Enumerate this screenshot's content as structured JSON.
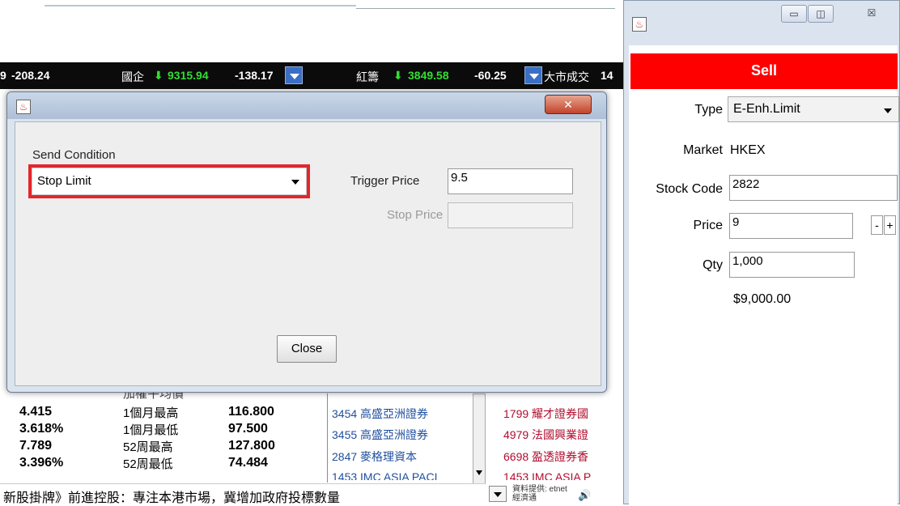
{
  "ticker": {
    "item1_change": "-208.24",
    "item2_label": "國企",
    "item2_arrow": "⬇",
    "item2_value": "9315.94",
    "item2_change": "-138.17",
    "item3_label": "紅籌",
    "item3_arrow": "⬇",
    "item3_value": "3849.58",
    "item3_change": "-60.25",
    "item4_label": "大市成交",
    "item4_value": "14",
    "lead_digit": "9"
  },
  "background_stats": {
    "col1": [
      "4.415",
      "3.618%",
      "7.789",
      "3.396%"
    ],
    "labels": [
      "1個月最高",
      "1個月最低",
      "52周最高",
      "52周最低"
    ],
    "values": [
      "116.800",
      "97.500",
      "127.800",
      "74.484"
    ],
    "partial_label": "加權平均價",
    "brokers_left": [
      "3454 高盛亞洲證券",
      "3455 高盛亞洲證券",
      "2847 麥格理資本",
      "1453 IMC ASIA PACI"
    ],
    "brokers_right": [
      "1799 耀才證券國",
      "4979 法國興業證",
      "6698 盈透證券香",
      "1453 IMC ASIA P"
    ],
    "news": "新股掛牌》前進控股：專注本港市場，冀增加政府投標數量",
    "source": "資料提供: etnet 經濟通"
  },
  "dialog": {
    "close_x": "✕",
    "send_condition_label": "Send Condition",
    "send_condition_value": "Stop Limit",
    "trigger_price_label": "Trigger Price",
    "trigger_price_value": "9.5",
    "stop_price_label": "Stop Price",
    "stop_price_value": "",
    "close_button": "Close",
    "highlight_color": "#e3262c"
  },
  "sell_window": {
    "minimize": "▭",
    "restore": "◫",
    "close": "☒",
    "banner": "Sell",
    "banner_color": "#ff0000",
    "type_label": "Type",
    "type_value": "E-Enh.Limit",
    "market_label": "Market",
    "market_value": "HKEX",
    "stock_code_label": "Stock Code",
    "stock_code_value": "2822",
    "price_label": "Price",
    "price_value": "9",
    "minus": "-",
    "plus": "+",
    "qty_label": "Qty",
    "qty_value": "1,000",
    "amount": "$9,000.00"
  }
}
